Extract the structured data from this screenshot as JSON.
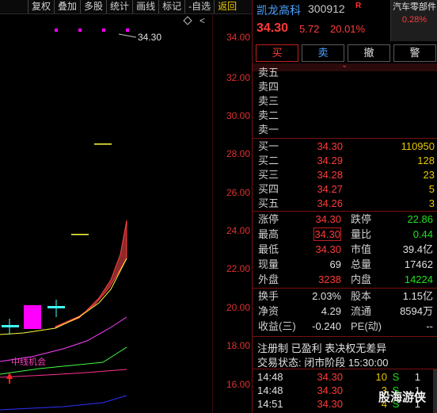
{
  "toolbar": {
    "items": [
      "复权",
      "叠加",
      "多股",
      "统计",
      "画线",
      "标记",
      "-自选",
      "返回"
    ]
  },
  "chart": {
    "y_ticks": [
      "34.00",
      "32.00",
      "30.00",
      "28.00",
      "26.00",
      "24.00",
      "22.00",
      "20.00",
      "18.00",
      "16.00"
    ],
    "max_label": "34.30",
    "cheap_label": "中线机会",
    "colors": {
      "band_fill": "#8b2a2a",
      "ma_yellow": "#ffff40",
      "ma_magenta": "#ff40ff",
      "ma_green": "#40ff40",
      "ma_pink": "#ff3090",
      "ma_blue": "#3030ff",
      "candle_up": "#ff00ff",
      "candle_doji": "#40ffff"
    }
  },
  "stock": {
    "name": "凯龙高科",
    "code": "300912",
    "flag": "R",
    "price": "34.30",
    "change": "5.72",
    "change_pct": "20.01%",
    "sector": "汽车零部件",
    "sector_pct": "0.28%"
  },
  "trade_buttons": {
    "buy": "买",
    "sell": "卖",
    "cancel": "撤",
    "alert": "警"
  },
  "ask_book": [
    {
      "label": "卖五",
      "price": "",
      "vol": ""
    },
    {
      "label": "卖四",
      "price": "",
      "vol": ""
    },
    {
      "label": "卖三",
      "price": "",
      "vol": ""
    },
    {
      "label": "卖二",
      "price": "",
      "vol": ""
    },
    {
      "label": "卖一",
      "price": "",
      "vol": ""
    }
  ],
  "bid_book": [
    {
      "label": "买一",
      "price": "34.30",
      "vol": "110950"
    },
    {
      "label": "买二",
      "price": "34.29",
      "vol": "128"
    },
    {
      "label": "买三",
      "price": "34.28",
      "vol": "23"
    },
    {
      "label": "买四",
      "price": "34.27",
      "vol": "5"
    },
    {
      "label": "买五",
      "price": "34.26",
      "vol": "3"
    }
  ],
  "stats": [
    {
      "l1": "涨停",
      "v1": "34.30",
      "l2": "跌停",
      "v2": "22.86"
    },
    {
      "l1": "最高",
      "v1": "34.30",
      "l2": "量比",
      "v2": "0.44"
    },
    {
      "l1": "最低",
      "v1": "34.30",
      "l2": "市值",
      "v2": "39.4亿"
    },
    {
      "l1": "现量",
      "v1": "69",
      "l2": "总量",
      "v2": "17462"
    },
    {
      "l1": "外盘",
      "v1": "3238",
      "l2": "内盘",
      "v2": "14224"
    }
  ],
  "stats2": [
    {
      "l1": "换手",
      "v1": "2.03%",
      "l2": "股本",
      "v2": "1.15亿"
    },
    {
      "l1": "净资",
      "v1": "4.29",
      "l2": "流通",
      "v2": "8594万"
    },
    {
      "l1": "收益(三)",
      "v1": "-0.240",
      "l2": "PE(动)",
      "v2": "--"
    }
  ],
  "info": {
    "tags": "注册制  已盈利  表决权无差异",
    "status": "交易状态: 闭市阶段 15:30:00"
  },
  "ticks": [
    {
      "time": "14:48",
      "price": "34.30",
      "qty": "10",
      "dir": "S",
      "n": "1"
    },
    {
      "time": "14:48",
      "price": "34.30",
      "qty": "3",
      "dir": "S",
      "n": "1"
    },
    {
      "time": "14:51",
      "price": "34.30",
      "qty": "4",
      "dir": "S",
      "n": "1"
    }
  ],
  "watermark": "股海游侠"
}
